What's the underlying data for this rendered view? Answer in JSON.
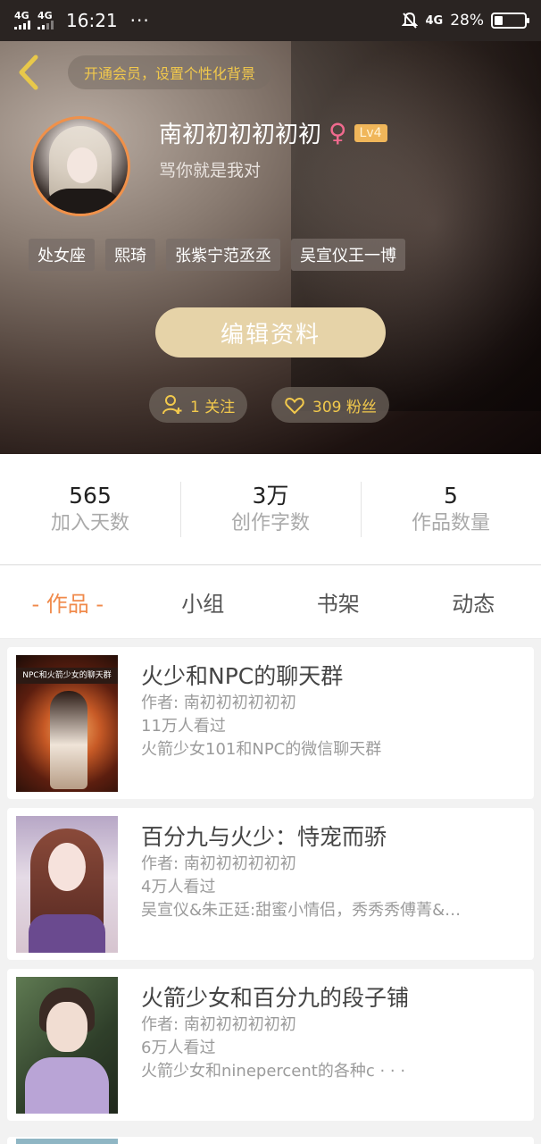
{
  "status_bar": {
    "network1": "4G",
    "network2": "4G",
    "time": "16:21",
    "more": "···",
    "signal_right": "4G",
    "battery": "28%"
  },
  "header": {
    "vip_text": "开通会员，设置个性化背景",
    "username": "南初初初初初初",
    "gender_symbol": "♀",
    "level": "Lv4",
    "signature": "骂你就是我对",
    "tags": [
      "处女座",
      "熙琦",
      "张紫宁范丞丞",
      "吴宣仪王一博"
    ],
    "edit_button": "编辑资料",
    "follow_count": "1 关注",
    "fans_count": "309 粉丝"
  },
  "stats": [
    {
      "value": "565",
      "label": "加入天数"
    },
    {
      "value": "3万",
      "label": "创作字数"
    },
    {
      "value": "5",
      "label": "作品数量"
    }
  ],
  "tabs": [
    "- 作品 -",
    "小组",
    "书架",
    "动态"
  ],
  "works": [
    {
      "cover_caption": "NPC和火箭少女的聊天群",
      "title": "火少和NPC的聊天群",
      "author": "作者: 南初初初初初初",
      "views": "11万人看过",
      "desc": "火箭少女101和NPC的微信聊天群"
    },
    {
      "title": "百分九与火少：恃宠而骄",
      "author": "作者: 南初初初初初初",
      "views": "4万人看过",
      "desc": "吴宣仪&朱正廷:甜蜜小情侣，秀秀秀傅菁&…"
    },
    {
      "title": "火箭少女和百分九的段子铺",
      "author": "作者: 南初初初初初初",
      "views": "6万人看过",
      "desc": "火箭少女和ninepercent的各种c · · ·"
    }
  ],
  "colors": {
    "accent": "#f08a4b",
    "gold": "#f2c94c",
    "edit_button": "#e6d3a8",
    "level_badge": "#f0b65a"
  }
}
